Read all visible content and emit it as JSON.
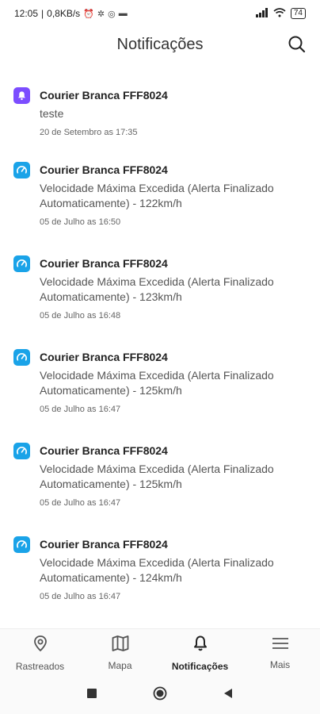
{
  "status_bar": {
    "time": "12:05",
    "network_speed": "0,8KB/s",
    "battery": "74"
  },
  "header": {
    "title": "Notificações",
    "search_icon": "search-icon"
  },
  "notifications": [
    {
      "icon": "bell-icon",
      "icon_color": "#7c4dff",
      "title": "Courier Branca FFF8024",
      "message": "teste",
      "date": "20 de Setembro as 17:35"
    },
    {
      "icon": "speedometer-icon",
      "icon_color": "#1aa3e8",
      "title": "Courier Branca FFF8024",
      "message": "Velocidade Máxima Excedida (Alerta Finalizado Automaticamente) - 122km/h",
      "date": "05 de Julho as 16:50"
    },
    {
      "icon": "speedometer-icon",
      "icon_color": "#1aa3e8",
      "title": "Courier Branca FFF8024",
      "message": "Velocidade Máxima Excedida (Alerta Finalizado Automaticamente) - 123km/h",
      "date": "05 de Julho as 16:48"
    },
    {
      "icon": "speedometer-icon",
      "icon_color": "#1aa3e8",
      "title": "Courier Branca FFF8024",
      "message": "Velocidade Máxima Excedida (Alerta Finalizado Automaticamente) - 125km/h",
      "date": "05 de Julho as 16:47"
    },
    {
      "icon": "speedometer-icon",
      "icon_color": "#1aa3e8",
      "title": "Courier Branca FFF8024",
      "message": "Velocidade Máxima Excedida (Alerta Finalizado Automaticamente) - 125km/h",
      "date": "05 de Julho as 16:47"
    },
    {
      "icon": "speedometer-icon",
      "icon_color": "#1aa3e8",
      "title": "Courier Branca FFF8024",
      "message": "Velocidade Máxima Excedida (Alerta Finalizado Automaticamente) - 124km/h",
      "date": "05 de Julho as 16:47"
    }
  ],
  "bottom_nav": {
    "items": [
      {
        "label": "Rastreados",
        "icon": "location-pin-icon"
      },
      {
        "label": "Mapa",
        "icon": "map-icon"
      },
      {
        "label": "Notificações",
        "icon": "bell-icon",
        "active": true
      },
      {
        "label": "Mais",
        "icon": "menu-icon"
      }
    ]
  }
}
